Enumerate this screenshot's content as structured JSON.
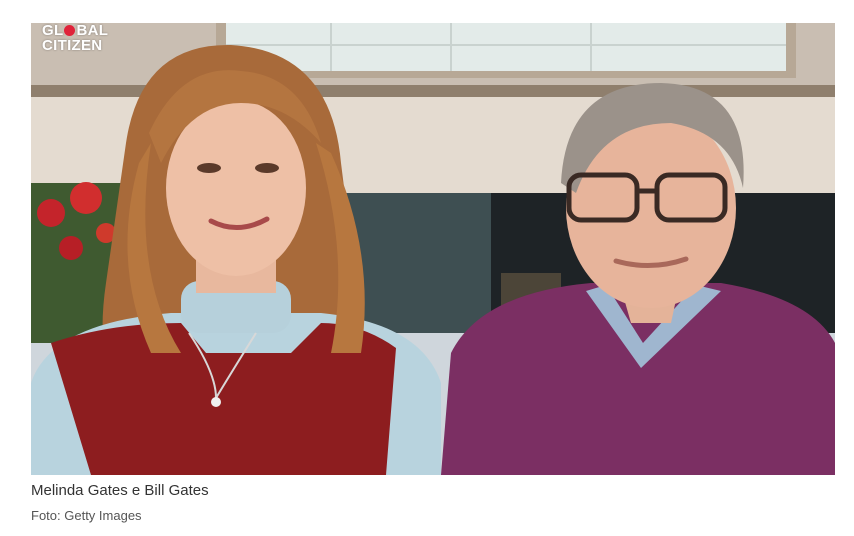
{
  "photo": {
    "logo_line1_part1": "GL",
    "logo_line1_part2": "BAL",
    "logo_line2": "CITIZEN",
    "logo_dot_color": "#e0233a"
  },
  "caption": "Melinda Gates e Bill Gates",
  "credit": "Foto: Getty Images"
}
